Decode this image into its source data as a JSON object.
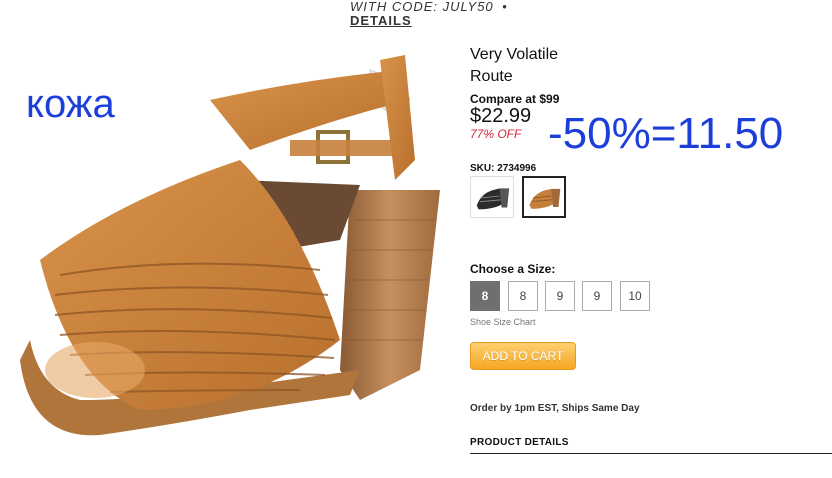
{
  "promo": {
    "code_text": "WITH CODE: JULY50",
    "separator": "•",
    "details_link": "DETAILS"
  },
  "annotations": {
    "material": "кожа",
    "discount_calc": "-50%=11.50",
    "color": "#1d3fd9"
  },
  "product": {
    "title_line1": "Very Volatile",
    "title_line2": "Route",
    "compare_at": "Compare at $99",
    "price": "$22.99",
    "percent_off": "77% OFF",
    "sku": "SKU: 2734996",
    "swatches": [
      {
        "color_name": "black",
        "selected": false
      },
      {
        "color_name": "tan",
        "selected": true
      }
    ]
  },
  "sizes": {
    "label": "Choose a Size:",
    "options": [
      "8",
      "8",
      "9",
      "9",
      "10"
    ],
    "selected_index": 0,
    "size_chart_link": "Shoe Size Chart"
  },
  "cart": {
    "button_label": "ADD TO CART",
    "accent": "#f5a623"
  },
  "shipping": {
    "note": "Order by 1pm EST, Ships Same Day"
  },
  "details": {
    "heading": "PRODUCT DETAILS"
  }
}
